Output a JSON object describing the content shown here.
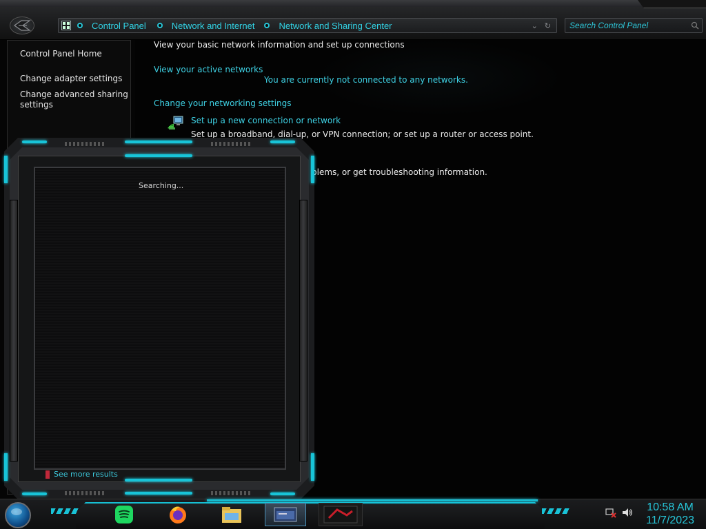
{
  "address_bar": {
    "crumbs": [
      "Control Panel",
      "Network and Internet",
      "Network and Sharing Center"
    ]
  },
  "search": {
    "placeholder": "Search Control Panel"
  },
  "left_pane": {
    "home": "Control Panel Home",
    "adapter": "Change adapter settings",
    "sharing_line1": "Change advanced sharing",
    "sharing_line2": "settings"
  },
  "main": {
    "heading": "View your basic network information and set up connections",
    "active_networks_label": "View your active networks",
    "not_connected": "You are currently not connected to any networks.",
    "change_settings_label": "Change your networking settings",
    "setup_link": "Set up a new connection or network",
    "setup_desc": "Set up a broadband, dial-up, or VPN connection; or set up a router or access point.",
    "troubleshoot_partial": "blems, or get troubleshooting information."
  },
  "start_menu": {
    "status": "Searching...",
    "see_more": "See more results"
  },
  "taskbar": {
    "apps": [
      "spotify-icon",
      "firefox-icon",
      "file-explorer-icon",
      "network-window-icon",
      "app-window-icon"
    ]
  },
  "clock": {
    "time": "10:58 AM",
    "date": "11/7/2023"
  },
  "colors": {
    "accent": "#18c4d8",
    "link": "#3fd3e6",
    "background": "#050505"
  }
}
